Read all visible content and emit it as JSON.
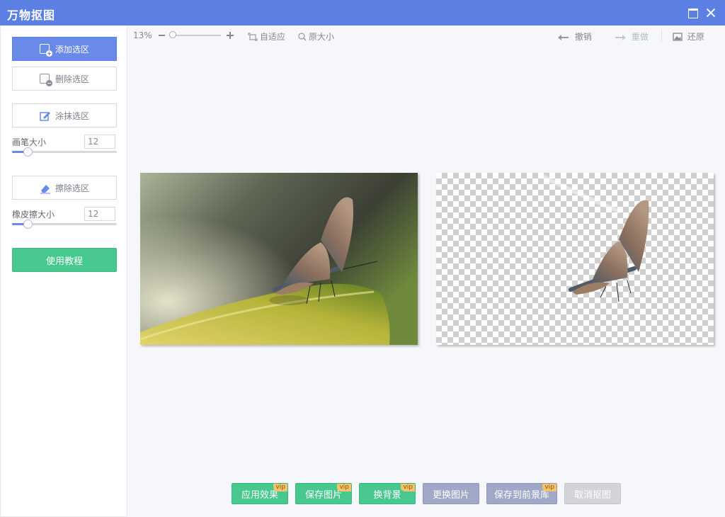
{
  "window": {
    "title": "万物抠图"
  },
  "sidebar": {
    "add_selection": "添加选区",
    "delete_selection": "删除选区",
    "paint_selection": "涂抹选区",
    "brush_size_label": "画笔大小",
    "brush_size_value": "12",
    "brush_size_fraction": 0.15,
    "erase_selection": "擦除选区",
    "eraser_size_label": "橡皮擦大小",
    "eraser_size_value": "12",
    "eraser_size_fraction": 0.15,
    "tutorial": "使用教程"
  },
  "toolbar": {
    "zoom": "13%",
    "zoom_fraction": 0.0,
    "fit": "自适应",
    "original_size": "原大小",
    "undo": "撤销",
    "redo": "重做",
    "restore": "还原"
  },
  "bottom": {
    "apply": "应用效果",
    "save_image": "保存图片",
    "change_background": "换背景",
    "replace_image": "更换图片",
    "save_to_foreground": "保存到前景库",
    "cancel": "取消抠图",
    "vip": "vip"
  },
  "colors": {
    "accent": "#5b7fe3",
    "green": "#47c88f",
    "vip": "#f2c36a"
  },
  "icons": [
    "maximize-icon",
    "close-icon",
    "add-selection-icon",
    "delete-selection-icon",
    "paint-icon",
    "eraser-icon",
    "fit-icon",
    "magnifier-icon",
    "undo-arrow-icon",
    "redo-arrow-icon",
    "image-icon"
  ]
}
